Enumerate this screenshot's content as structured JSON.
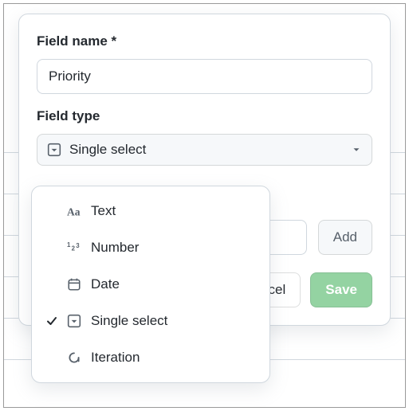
{
  "form": {
    "field_name_label": "Field name *",
    "field_name_value": "Priority",
    "field_type_label": "Field type",
    "selected_type": "Single select",
    "option_placeholder": "",
    "add_button": "Add",
    "cancel_button": "Cancel",
    "save_button": "Save"
  },
  "dropdown": {
    "items": [
      {
        "label": "Text",
        "checked": false
      },
      {
        "label": "Number",
        "checked": false
      },
      {
        "label": "Date",
        "checked": false
      },
      {
        "label": "Single select",
        "checked": true
      },
      {
        "label": "Iteration",
        "checked": false
      }
    ]
  }
}
